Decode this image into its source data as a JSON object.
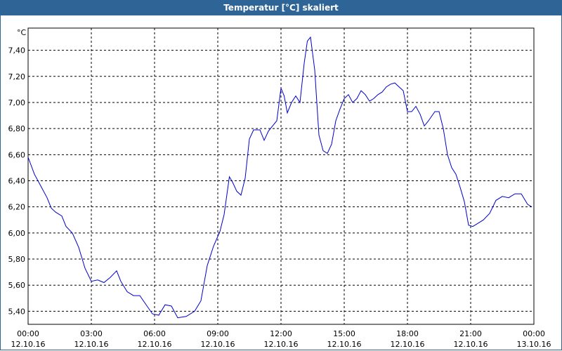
{
  "chart_data": {
    "type": "line",
    "title": "Temperatur [°C] skaliert",
    "ylabel": "°C",
    "xlabel": "",
    "ylim": [
      5.3,
      7.57
    ],
    "xlim": [
      0,
      24
    ],
    "grid": true,
    "y_ticks": [
      "5,40",
      "5,60",
      "5,80",
      "6,00",
      "6,20",
      "6,40",
      "6,60",
      "6,80",
      "7,00",
      "7,20",
      "7,40"
    ],
    "y_tick_values": [
      5.4,
      5.6,
      5.8,
      6.0,
      6.2,
      6.4,
      6.6,
      6.8,
      7.0,
      7.2,
      7.4
    ],
    "x_ticks": [
      {
        "time": "00:00",
        "date": "12.10.16"
      },
      {
        "time": "03:00",
        "date": "12.10.16"
      },
      {
        "time": "06:00",
        "date": "12.10.16"
      },
      {
        "time": "09:00",
        "date": "12.10.16"
      },
      {
        "time": "12:00",
        "date": "12.10.16"
      },
      {
        "time": "15:00",
        "date": "12.10.16"
      },
      {
        "time": "18:00",
        "date": "12.10.16"
      },
      {
        "time": "21:00",
        "date": "12.10.16"
      },
      {
        "time": "00:00",
        "date": "13.10.16"
      }
    ],
    "line_color": "#0000cc",
    "series": [
      {
        "x": [
          0,
          0.3,
          0.6,
          0.9,
          1.1,
          1.3,
          1.6,
          1.8,
          2.1,
          2.4,
          2.7,
          3.0,
          3.3,
          3.6,
          3.9,
          4.2,
          4.4,
          4.7,
          5.0,
          5.3,
          5.6,
          5.9,
          6.2,
          6.5,
          6.8,
          7.1,
          7.5,
          7.9,
          8.2,
          8.5,
          8.8,
          9.1,
          9.3,
          9.55,
          9.7,
          9.9,
          10.1,
          10.3,
          10.5,
          10.7,
          11.0,
          11.2,
          11.4,
          11.6,
          11.8,
          12.0,
          12.15,
          12.3,
          12.5,
          12.7,
          12.9,
          13.1,
          13.25,
          13.4,
          13.6,
          13.8,
          14.0,
          14.2,
          14.4,
          14.6,
          14.8,
          15.0,
          15.2,
          15.4,
          15.6,
          15.8,
          16.0,
          16.2,
          16.4,
          16.6,
          16.8,
          17.0,
          17.2,
          17.4,
          17.6,
          17.8,
          18.0,
          18.2,
          18.4,
          18.6,
          18.8,
          19.0,
          19.3,
          19.5,
          19.7,
          19.9,
          20.1,
          20.3,
          20.5,
          20.7,
          20.9,
          21.1,
          21.3,
          21.6,
          21.9,
          22.2,
          22.5,
          22.8,
          23.1,
          23.4,
          23.7,
          23.9
        ],
        "values": [
          6.58,
          6.45,
          6.36,
          6.27,
          6.19,
          6.16,
          6.13,
          6.05,
          6.0,
          5.89,
          5.73,
          5.63,
          5.64,
          5.62,
          5.66,
          5.71,
          5.63,
          5.55,
          5.52,
          5.52,
          5.45,
          5.38,
          5.37,
          5.45,
          5.44,
          5.35,
          5.36,
          5.4,
          5.48,
          5.75,
          5.9,
          6.01,
          6.14,
          6.43,
          6.39,
          6.32,
          6.29,
          6.42,
          6.72,
          6.79,
          6.79,
          6.71,
          6.78,
          6.82,
          6.86,
          7.11,
          7.05,
          6.92,
          7.0,
          7.05,
          7.0,
          7.3,
          7.47,
          7.5,
          7.25,
          6.75,
          6.63,
          6.61,
          6.68,
          6.86,
          6.95,
          7.03,
          7.06,
          7.0,
          7.03,
          7.09,
          7.06,
          7.01,
          7.03,
          7.06,
          7.08,
          7.12,
          7.14,
          7.15,
          7.12,
          7.09,
          6.93,
          6.93,
          6.97,
          6.91,
          6.82,
          6.86,
          6.93,
          6.93,
          6.8,
          6.6,
          6.5,
          6.45,
          6.35,
          6.24,
          6.06,
          6.05,
          6.07,
          6.1,
          6.15,
          6.25,
          6.28,
          6.27,
          6.3,
          6.3,
          6.22,
          6.2
        ]
      }
    ]
  }
}
